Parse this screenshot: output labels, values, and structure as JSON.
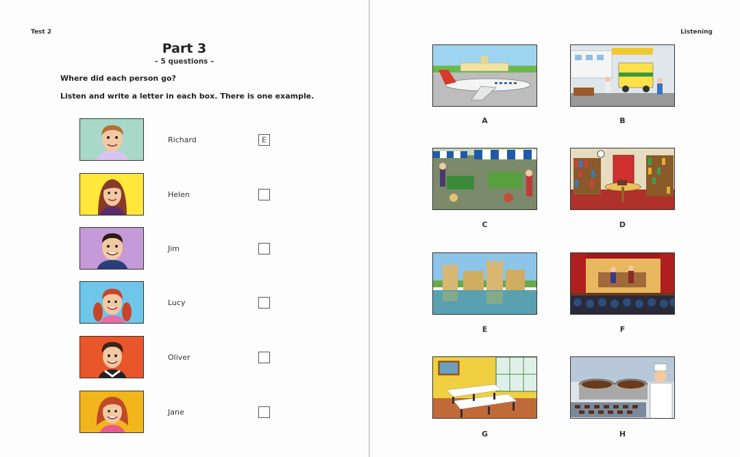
{
  "header": {
    "left_label": "Test 2",
    "right_label": "Listening"
  },
  "part": {
    "title": "Part 3",
    "subtitle": "– 5 questions –",
    "question": "Where did each person go?",
    "instruction": "Listen and write a letter in each box. There is one example."
  },
  "people": [
    {
      "name": "Richard",
      "answer": "E",
      "bg": "#a8d8c8"
    },
    {
      "name": "Helen",
      "answer": "",
      "bg": "#ffe83a"
    },
    {
      "name": "Jim",
      "answer": "",
      "bg": "#c59ad8"
    },
    {
      "name": "Lucy",
      "answer": "",
      "bg": "#6ec6ea"
    },
    {
      "name": "Oliver",
      "answer": "",
      "bg": "#e8562a"
    },
    {
      "name": "Jane",
      "answer": "",
      "bg": "#f2b51c"
    }
  ],
  "pictures": [
    {
      "letter": "A",
      "scene": "airport"
    },
    {
      "letter": "B",
      "scene": "hospital"
    },
    {
      "letter": "C",
      "scene": "market"
    },
    {
      "letter": "D",
      "scene": "library"
    },
    {
      "letter": "E",
      "scene": "castle"
    },
    {
      "letter": "F",
      "scene": "theatre"
    },
    {
      "letter": "G",
      "scene": "restaurant"
    },
    {
      "letter": "H",
      "scene": "chocolate-factory"
    }
  ]
}
